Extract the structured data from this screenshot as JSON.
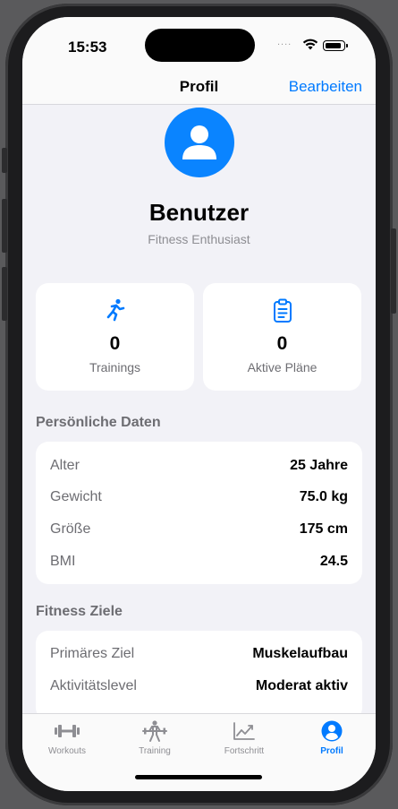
{
  "status_bar": {
    "time": "15:53",
    "signal": "....",
    "wifi_icon": "wifi-icon",
    "battery_icon": "battery-icon"
  },
  "nav": {
    "title": "Profil",
    "edit_label": "Bearbeiten"
  },
  "profile": {
    "avatar_icon": "person-circle-icon",
    "name": "Benutzer",
    "subtitle": "Fitness Enthusiast"
  },
  "stats": [
    {
      "icon": "running-figure-icon",
      "value": "0",
      "label": "Trainings"
    },
    {
      "icon": "clipboard-icon",
      "value": "0",
      "label": "Aktive Pläne"
    }
  ],
  "personal": {
    "title": "Persönliche Daten",
    "rows": [
      {
        "label": "Alter",
        "value": "25 Jahre"
      },
      {
        "label": "Gewicht",
        "value": "75.0 kg"
      },
      {
        "label": "Größe",
        "value": "175 cm"
      },
      {
        "label": "BMI",
        "value": "24.5"
      }
    ]
  },
  "goals": {
    "title": "Fitness Ziele",
    "rows": [
      {
        "label": "Primäres Ziel",
        "value": "Muskelaufbau"
      },
      {
        "label": "Aktivitätslevel",
        "value": "Moderat aktiv"
      }
    ]
  },
  "tabs": [
    {
      "label": "Workouts",
      "icon": "dumbbell-icon",
      "active": false
    },
    {
      "label": "Training",
      "icon": "weightlifter-icon",
      "active": false
    },
    {
      "label": "Fortschritt",
      "icon": "chart-line-icon",
      "active": false
    },
    {
      "label": "Profil",
      "icon": "person-circle-icon",
      "active": true
    }
  ],
  "colors": {
    "accent": "#007aff",
    "background": "#f2f2f7",
    "inactive": "#8e8e93"
  }
}
